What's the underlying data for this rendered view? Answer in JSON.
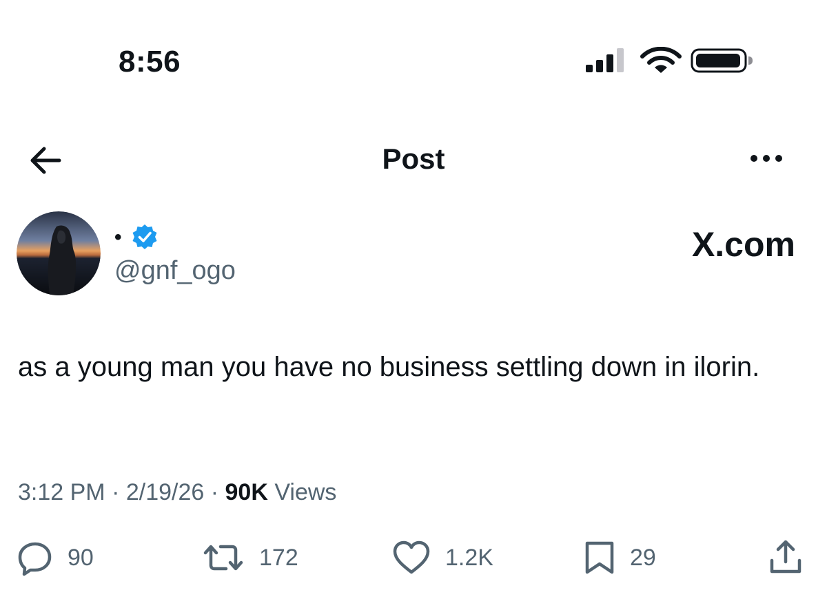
{
  "status_bar": {
    "time": "8:56",
    "icons": [
      "signal-icon",
      "wifi-icon",
      "battery-icon"
    ]
  },
  "nav": {
    "title": "Post",
    "back_icon": "back-arrow-icon",
    "more_icon": "more-icon"
  },
  "author": {
    "display_name": "•",
    "verified": true,
    "handle": "@gnf_ogo"
  },
  "watermark": "X.com",
  "post": {
    "text": "as a young man you have no business settling down in ilorin."
  },
  "meta": {
    "time": "3:12 PM",
    "sep1": " · ",
    "date": "2/19/26",
    "sep2": " · ",
    "views_count": "90K",
    "views_label": " Views"
  },
  "actions": {
    "replies": "90",
    "reposts": "172",
    "likes": "1.2K",
    "bookmarks": "29"
  },
  "colors": {
    "text": "#0f1419",
    "secondary": "#536471",
    "verified_badge": "#1d9bf0",
    "background": "#ffffff"
  }
}
